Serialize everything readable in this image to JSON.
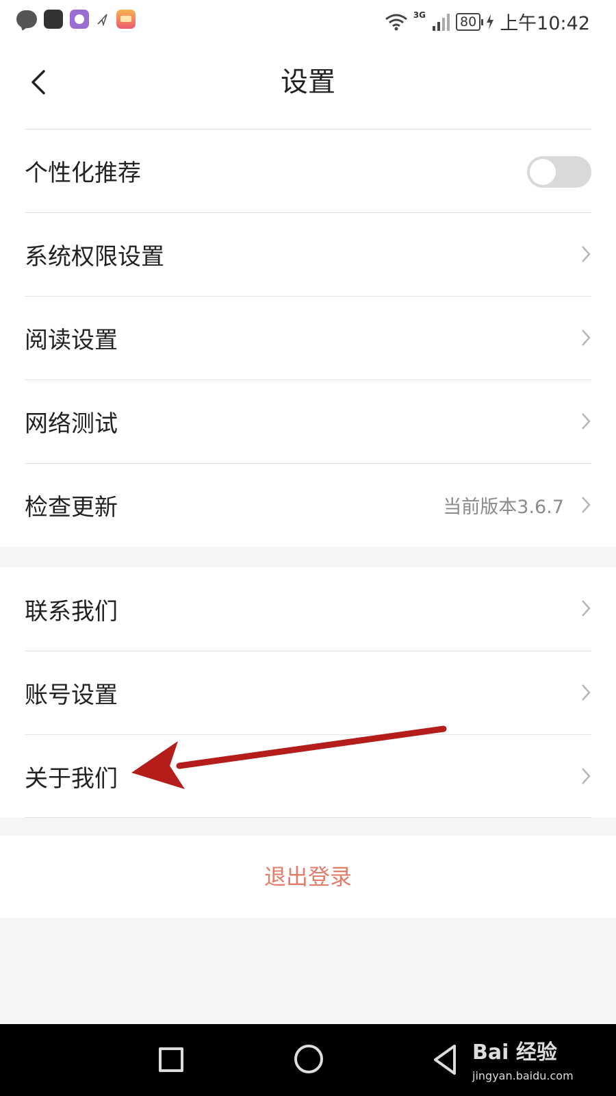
{
  "status_bar": {
    "time": "上午10:42",
    "battery": "80",
    "network": "3G"
  },
  "header": {
    "title": "设置"
  },
  "groups": [
    {
      "items": [
        {
          "label": "个性化推荐",
          "control": "toggle",
          "toggle_on": false
        },
        {
          "label": "系统权限设置"
        },
        {
          "label": "阅读设置"
        },
        {
          "label": "网络测试"
        },
        {
          "label": "检查更新",
          "value": "当前版本3.6.7"
        }
      ]
    },
    {
      "items": [
        {
          "label": "联系我们"
        },
        {
          "label": "账号设置"
        },
        {
          "label": "关于我们"
        }
      ]
    }
  ],
  "logout": {
    "label": "退出登录"
  },
  "watermark": {
    "brand": "Bai 经验",
    "url": "jingyan.baidu.com"
  },
  "colors": {
    "logout_text": "#e27c6b",
    "annotation_arrow": "#b51d1a",
    "toggle_off": "#d9d9d9"
  },
  "icons": {
    "status_left": [
      "message-icon",
      "huawei-store-icon",
      "pie-app-icon",
      "navigation-icon",
      "gallery-icon"
    ],
    "status_right": [
      "wifi-icon",
      "signal-icon",
      "battery-icon",
      "charging-icon"
    ],
    "nav": [
      "recent-apps-icon",
      "home-icon",
      "back-icon"
    ]
  }
}
